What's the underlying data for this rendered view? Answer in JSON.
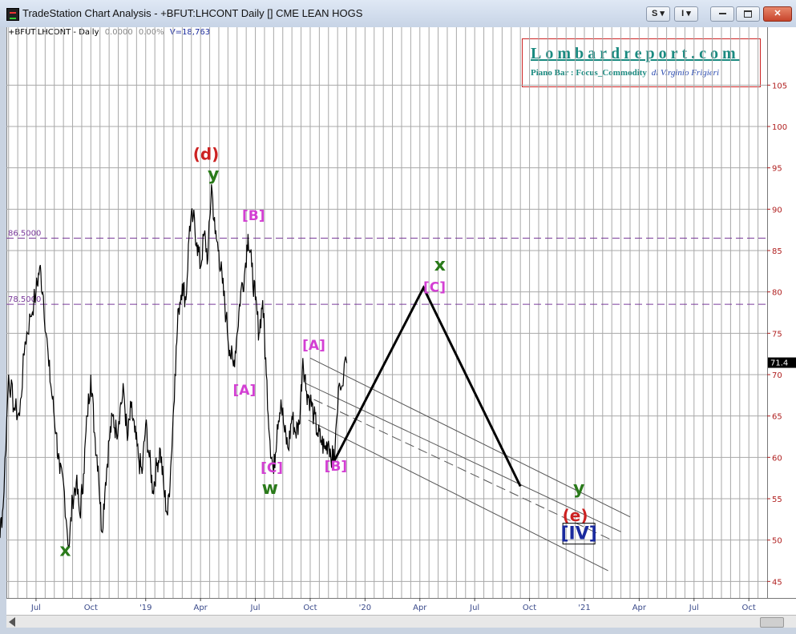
{
  "window": {
    "title": "TradeStation Chart Analysis - +BFUT:LHCONT Daily [] CME LEAN HOGS",
    "buttons": [
      "S ▾",
      "I ▾"
    ]
  },
  "symbol_bar": {
    "symbol": "+BFUT:LHCONT - Daily",
    "change": "0.0000",
    "pct": "0.00%",
    "volume": "V=18,763"
  },
  "logo": {
    "name": "Lombardreport.com",
    "line2_bold": "Piano Bar : Focus_Commodity",
    "line2_italic": "di Virginio Frigieri"
  },
  "colors": {
    "price": "#000000",
    "wave_green": "#2a7a1a",
    "wave_magenta": "#d33fd3",
    "wave_red": "#cc2222",
    "wave_blue": "#1a2a9e",
    "hline": "#7a3a9a",
    "axis_red": "#b02020",
    "logo_teal": "#1a8a80"
  },
  "chart_data": {
    "type": "line",
    "title": "+BFUT:LHCONT Daily CME LEAN HOGS",
    "x_axis": {
      "unit": "months since Jan 2018",
      "range": [
        4.38,
        35.0
      ],
      "ticks": [
        {
          "m": 6,
          "label": "Jul"
        },
        {
          "m": 9,
          "label": "Oct"
        },
        {
          "m": 12,
          "label": "'19"
        },
        {
          "m": 15,
          "label": "Apr"
        },
        {
          "m": 18,
          "label": "Jul"
        },
        {
          "m": 21,
          "label": "Oct"
        },
        {
          "m": 24,
          "label": "'20"
        },
        {
          "m": 27,
          "label": "Apr"
        },
        {
          "m": 30,
          "label": "Jul"
        },
        {
          "m": 33,
          "label": "Oct"
        },
        {
          "m": 36,
          "label": "'21"
        },
        {
          "m": 39,
          "label": "Apr"
        },
        {
          "m": 42,
          "label": "Jul"
        },
        {
          "m": 45,
          "label": "Oct"
        }
      ]
    },
    "y_axis": {
      "range": [
        43.0,
        112.0
      ],
      "ticks": [
        45,
        50,
        55,
        60,
        65,
        70,
        75,
        80,
        85,
        90,
        95,
        100,
        105
      ]
    },
    "last_price_label": "71.4",
    "grid": true,
    "price_series": {
      "name": "",
      "points": [
        [
          3.6,
          67.5
        ],
        [
          3.8,
          58
        ],
        [
          4.0,
          50.5
        ],
        [
          4.2,
          54
        ],
        [
          4.5,
          70
        ],
        [
          4.8,
          66
        ],
        [
          5.1,
          65
        ],
        [
          5.4,
          74
        ],
        [
          5.7,
          77
        ],
        [
          6.0,
          80
        ],
        [
          6.2,
          83
        ],
        [
          6.4,
          79.5
        ],
        [
          6.7,
          71
        ],
        [
          6.9,
          67
        ],
        [
          7.1,
          63
        ],
        [
          7.3,
          58
        ],
        [
          7.5,
          57
        ],
        [
          7.8,
          49
        ],
        [
          8.0,
          55
        ],
        [
          8.2,
          57
        ],
        [
          8.4,
          53
        ],
        [
          8.6,
          58
        ],
        [
          8.8,
          65
        ],
        [
          9.0,
          70
        ],
        [
          9.2,
          63
        ],
        [
          9.4,
          59
        ],
        [
          9.6,
          51
        ],
        [
          9.8,
          57
        ],
        [
          10.0,
          62
        ],
        [
          10.2,
          65
        ],
        [
          10.4,
          63
        ],
        [
          10.6,
          66
        ],
        [
          10.8,
          68
        ],
        [
          11.0,
          62
        ],
        [
          11.2,
          66
        ],
        [
          11.4,
          63
        ],
        [
          11.6,
          60
        ],
        [
          11.8,
          58
        ],
        [
          12.0,
          64
        ],
        [
          12.2,
          60
        ],
        [
          12.4,
          56
        ],
        [
          12.6,
          59
        ],
        [
          12.8,
          61
        ],
        [
          13.0,
          56
        ],
        [
          13.2,
          53
        ],
        [
          13.4,
          60
        ],
        [
          13.6,
          70
        ],
        [
          13.8,
          78
        ],
        [
          14.0,
          81
        ],
        [
          14.2,
          79
        ],
        [
          14.4,
          88
        ],
        [
          14.6,
          89
        ],
        [
          14.8,
          86
        ],
        [
          15.0,
          83
        ],
        [
          15.2,
          87
        ],
        [
          15.4,
          84
        ],
        [
          15.6,
          93
        ],
        [
          15.8,
          87
        ],
        [
          16.0,
          85
        ],
        [
          16.2,
          81
        ],
        [
          16.4,
          77
        ],
        [
          16.6,
          73
        ],
        [
          16.8,
          71
        ],
        [
          17.0,
          75
        ],
        [
          17.2,
          80
        ],
        [
          17.4,
          82
        ],
        [
          17.6,
          87
        ],
        [
          17.8,
          83
        ],
        [
          18.0,
          79
        ],
        [
          18.2,
          75
        ],
        [
          18.4,
          79
        ],
        [
          18.6,
          70
        ],
        [
          18.8,
          62
        ],
        [
          19.0,
          58
        ],
        [
          19.2,
          64
        ],
        [
          19.4,
          67
        ],
        [
          19.6,
          63
        ],
        [
          19.8,
          61
        ],
        [
          20.0,
          65
        ],
        [
          20.2,
          63
        ],
        [
          20.4,
          64
        ],
        [
          20.6,
          72
        ],
        [
          20.8,
          68
        ],
        [
          21.0,
          67
        ],
        [
          21.2,
          65
        ],
        [
          21.4,
          63
        ],
        [
          21.6,
          62
        ],
        [
          21.8,
          61
        ],
        [
          22.0,
          62
        ],
        [
          22.2,
          60
        ],
        [
          22.3,
          59.5
        ],
        [
          22.6,
          69
        ],
        [
          23.0,
          71.4
        ]
      ]
    },
    "projection": {
      "points": [
        [
          22.3,
          59.5
        ],
        [
          27.2,
          80.5
        ],
        [
          32.5,
          56.5
        ]
      ]
    },
    "channel_lines": [
      {
        "name": "upper",
        "style": "solid",
        "points": [
          [
            21.0,
            72.0
          ],
          [
            38.5,
            52.8
          ]
        ]
      },
      {
        "name": "upper2",
        "style": "solid",
        "points": [
          [
            20.7,
            69.0
          ],
          [
            38.0,
            51.0
          ]
        ]
      },
      {
        "name": "middle",
        "style": "dashed",
        "points": [
          [
            21.2,
            67.0
          ],
          [
            37.5,
            50.0
          ]
        ]
      },
      {
        "name": "lower",
        "style": "solid",
        "points": [
          [
            20.9,
            64.5
          ],
          [
            37.3,
            46.3
          ]
        ]
      }
    ],
    "horizontal_lines": [
      {
        "label": "86.5000",
        "value": 86.5
      },
      {
        "label": "78.5000",
        "value": 78.5
      }
    ],
    "wave_labels": [
      {
        "text": "(d)",
        "m": 15.3,
        "y": 96.0,
        "color": "wave_red",
        "size": 20
      },
      {
        "text": "y",
        "m": 15.7,
        "y": 93.5,
        "color": "wave_green",
        "size": 22
      },
      {
        "text": "[B]",
        "m": 17.9,
        "y": 88.7,
        "color": "wave_magenta",
        "size": 17
      },
      {
        "text": "x",
        "m": 28.1,
        "y": 82.6,
        "color": "wave_green",
        "size": 22
      },
      {
        "text": "[C]",
        "m": 27.8,
        "y": 80.0,
        "color": "wave_magenta",
        "size": 17
      },
      {
        "text": "[A]",
        "m": 21.2,
        "y": 73.0,
        "color": "wave_magenta",
        "size": 17
      },
      {
        "text": "[A]",
        "m": 17.4,
        "y": 67.6,
        "color": "wave_magenta",
        "size": 17
      },
      {
        "text": "[C]",
        "m": 18.9,
        "y": 58.2,
        "color": "wave_magenta",
        "size": 17
      },
      {
        "text": "[B]",
        "m": 22.4,
        "y": 58.4,
        "color": "wave_magenta",
        "size": 17
      },
      {
        "text": "w",
        "m": 18.8,
        "y": 55.6,
        "color": "wave_green",
        "size": 22
      },
      {
        "text": "x",
        "m": 7.6,
        "y": 48.1,
        "color": "wave_green",
        "size": 22
      },
      {
        "text": "y",
        "m": 35.7,
        "y": 55.6,
        "color": "wave_green",
        "size": 22
      },
      {
        "text": "(e)",
        "m": 35.5,
        "y": 52.3,
        "color": "wave_red",
        "size": 20
      },
      {
        "text": "[IV]",
        "m": 35.7,
        "y": 50.1,
        "color": "wave_blue",
        "size": 22,
        "boxed": true
      }
    ]
  }
}
